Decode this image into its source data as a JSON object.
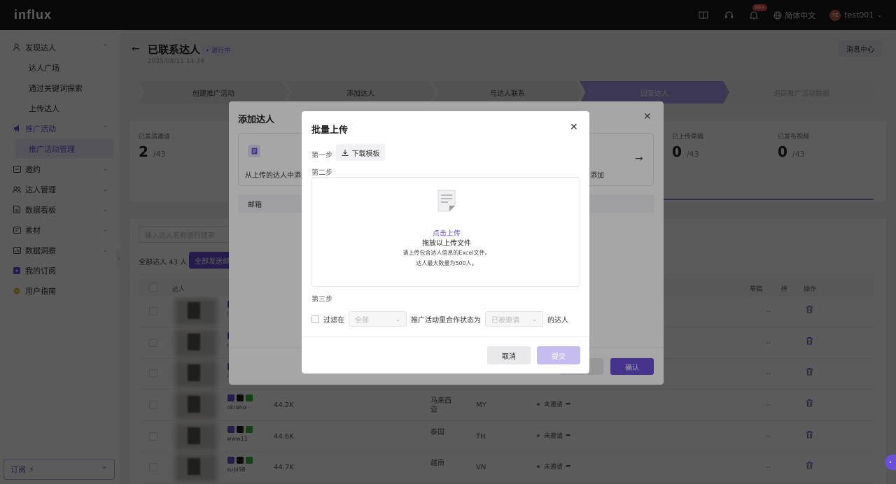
{
  "topbar": {
    "logo": "influx",
    "notification_badge": "99+",
    "language": "简体中文",
    "avatar_initials": "TE",
    "username": "test001"
  },
  "sidebar": {
    "items": [
      {
        "label": "发现达人",
        "icon": "user-search-icon",
        "expanded": true
      },
      {
        "label": "达人广场",
        "sub": true
      },
      {
        "label": "通过关键词探索",
        "sub": true
      },
      {
        "label": "上传达人",
        "sub": true
      },
      {
        "label": "推广活动",
        "icon": "megaphone-icon",
        "expanded": true,
        "active": true
      },
      {
        "label": "推广活动管理",
        "sub": true,
        "active": true
      },
      {
        "label": "邀约",
        "icon": "mail-icon"
      },
      {
        "label": "达人管理",
        "icon": "users-icon"
      },
      {
        "label": "数据看板",
        "icon": "dashboard-icon"
      },
      {
        "label": "素材",
        "icon": "media-icon"
      },
      {
        "label": "数据洞察",
        "icon": "chart-icon"
      },
      {
        "label": "我的订阅",
        "icon": "subscription-icon"
      },
      {
        "label": "用户指南",
        "icon": "guide-icon"
      }
    ],
    "subscription_label": "订阅"
  },
  "header": {
    "title": "已联系达人",
    "status": "进行中",
    "date": "2025/08/11 14:34",
    "message_center": "消息中心"
  },
  "steps": [
    {
      "label": "创建推广活动",
      "state": "done"
    },
    {
      "label": "添加达人",
      "state": "done"
    },
    {
      "label": "与达人联系",
      "state": "done"
    },
    {
      "label": "回复达人",
      "state": "active"
    },
    {
      "label": "追踪推广活动数据",
      "state": "upcoming"
    }
  ],
  "stats": [
    {
      "label": "已发送邀请",
      "value": "2",
      "total": "/43"
    },
    {
      "label": "已上传草稿",
      "value": "0",
      "total": "/43"
    },
    {
      "label": "已发布视频",
      "value": "0",
      "total": "/43"
    }
  ],
  "list": {
    "search_placeholder": "输入达人名称进行搜索",
    "all_count_label": "全部达人",
    "all_count": "43 人",
    "send_all_button": "全部发送邮",
    "columns": {
      "creator": "达人",
      "draft": "草稿",
      "other": "样",
      "actions": "操作"
    },
    "rows": [
      {
        "handle": "ijan",
        "followers": "",
        "country": "",
        "code": "",
        "invite": "",
        "placeholder": "--"
      },
      {
        "handle": "n",
        "followers": "",
        "country": "",
        "code": "",
        "invite": "",
        "placeholder": "--"
      },
      {
        "handle": "irw",
        "followers": "",
        "country": "",
        "code": "",
        "invite": "",
        "placeholder": "--"
      },
      {
        "handle": "okraho···",
        "followers": "44.2K",
        "country": "马来西亚",
        "code": "MY",
        "invite": "未邀请",
        "placeholder": "--"
      },
      {
        "handle": "www11",
        "followers": "44.6K",
        "country": "泰国",
        "code": "TH",
        "invite": "未邀请",
        "placeholder": "--"
      },
      {
        "handle": "subi98",
        "followers": "44.7K",
        "country": "越南",
        "code": "VN",
        "invite": "未邀请",
        "placeholder": "--"
      }
    ]
  },
  "add_dialog": {
    "title": "添加达人",
    "option_left": "从上传的达人中添加",
    "option_right": "添加",
    "email_tab": "邮箱",
    "confirm": "确认"
  },
  "upload_dialog": {
    "title": "批量上传",
    "step1": "第一步",
    "download_template": "下载模板",
    "step2": "第二步",
    "click_upload": "点击上传",
    "drag_text": "拖放以上传文件",
    "hint1": "请上传包含达人信息的Excel文件。",
    "hint2": "达人最大数量为500人。",
    "step3": "第三步",
    "filter_label": "过滤在",
    "filter_select1": "全部",
    "filter_middle": "推广活动里合作状态为",
    "filter_select2": "已被邀请",
    "filter_suffix": "的达人",
    "cancel": "取消",
    "submit": "提交"
  },
  "colors": {
    "accent": "#6b4fd8",
    "submit_disabled": "#c7bcf2"
  }
}
